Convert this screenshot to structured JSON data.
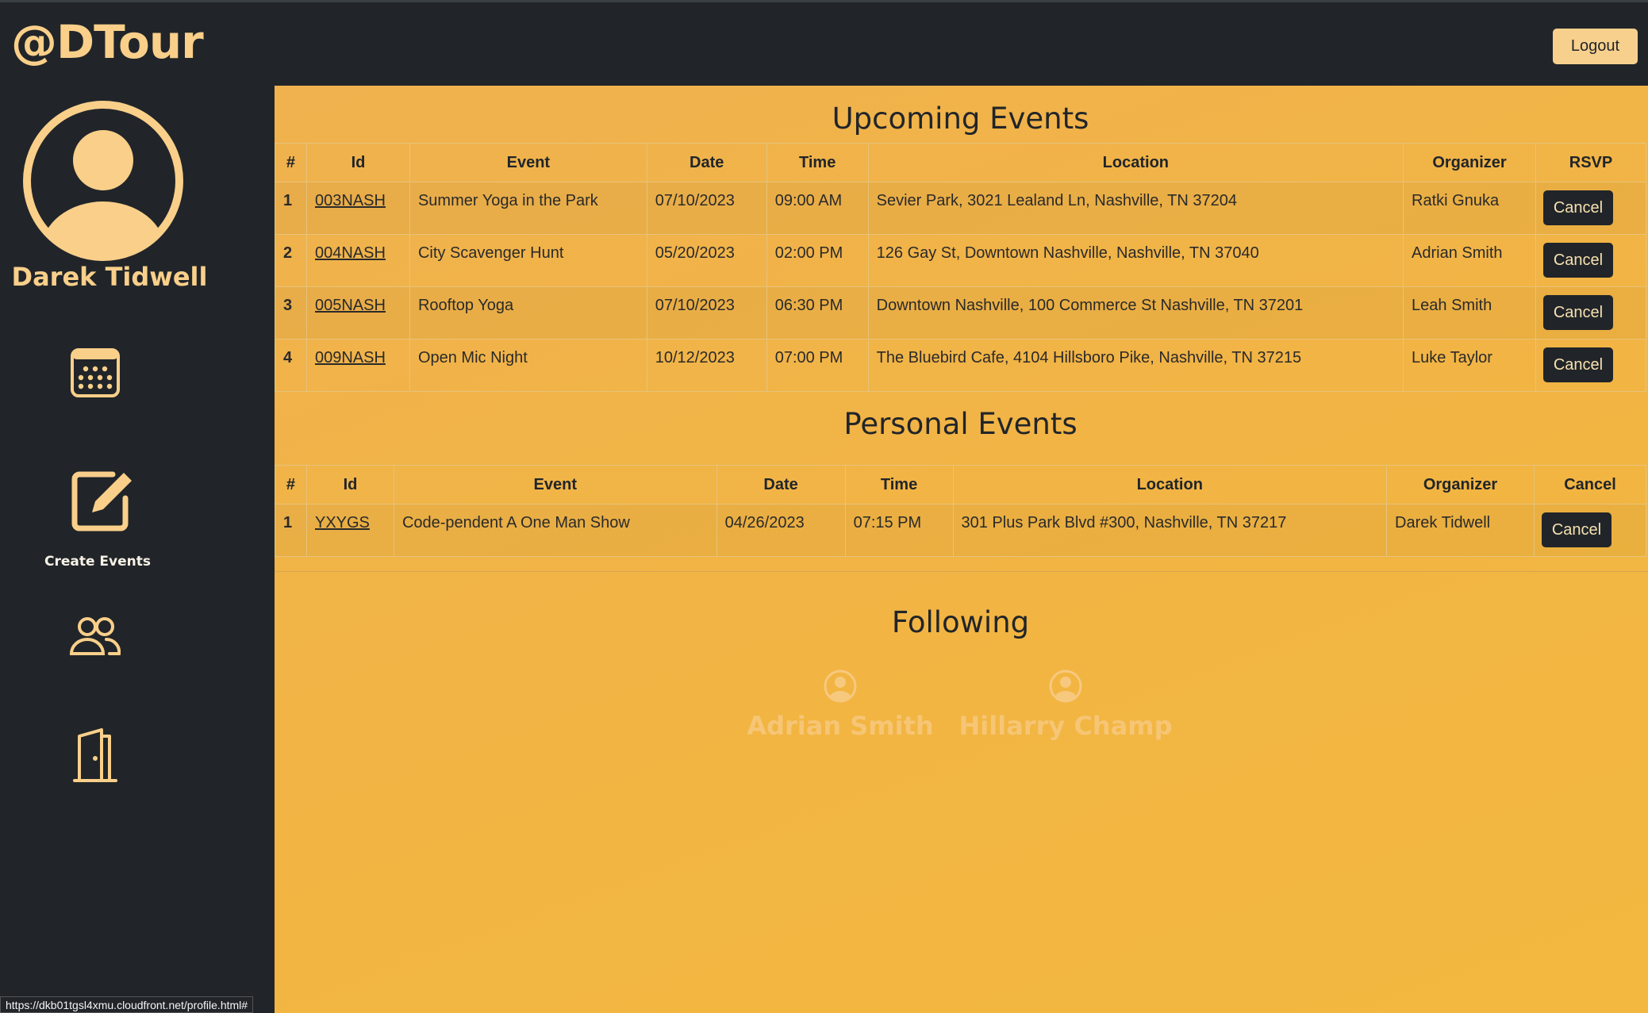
{
  "header": {
    "brand": "@DTour",
    "logout_label": "Logout"
  },
  "sidebar": {
    "user_name": "Darek Tidwell",
    "create_events_label": "Create Events",
    "icons": [
      "avatar-icon",
      "calendar-icon",
      "edit-icon",
      "users-icon",
      "door-icon"
    ]
  },
  "upcoming": {
    "title": "Upcoming Events",
    "headers": [
      "#",
      "Id",
      "Event",
      "Date",
      "Time",
      "Location",
      "Organizer",
      "RSVP"
    ],
    "rows": [
      {
        "num": "1",
        "id": "003NASH",
        "event": "Summer Yoga in the Park",
        "date": "07/10/2023",
        "time": "09:00 AM",
        "location": "Sevier Park, 3021 Lealand Ln, Nashville, TN 37204",
        "organizer": "Ratki Gnuka",
        "action": "Cancel"
      },
      {
        "num": "2",
        "id": "004NASH",
        "event": "City Scavenger Hunt",
        "date": "05/20/2023",
        "time": "02:00 PM",
        "location": "126 Gay St, Downtown Nashville, Nashville, TN 37040",
        "organizer": "Adrian Smith",
        "action": "Cancel"
      },
      {
        "num": "3",
        "id": "005NASH",
        "event": "Rooftop Yoga",
        "date": "07/10/2023",
        "time": "06:30 PM",
        "location": "Downtown Nashville, 100 Commerce St Nashville, TN 37201",
        "organizer": "Leah Smith",
        "action": "Cancel"
      },
      {
        "num": "4",
        "id": "009NASH",
        "event": "Open Mic Night",
        "date": "10/12/2023",
        "time": "07:00 PM",
        "location": "The Bluebird Cafe, 4104 Hillsboro Pike, Nashville, TN 37215",
        "organizer": "Luke Taylor",
        "action": "Cancel"
      }
    ]
  },
  "personal": {
    "title": "Personal Events",
    "headers": [
      "#",
      "Id",
      "Event",
      "Date",
      "Time",
      "Location",
      "Organizer",
      "Cancel"
    ],
    "rows": [
      {
        "num": "1",
        "id": "YXYGS",
        "event": "Code-pendent A One Man Show",
        "date": "04/26/2023",
        "time": "07:15 PM",
        "location": "301 Plus Park Blvd #300, Nashville, TN 37217",
        "organizer": "Darek Tidwell",
        "action": "Cancel"
      }
    ]
  },
  "following": {
    "title": "Following",
    "people": [
      {
        "name": "Adrian Smith"
      },
      {
        "name": "Hillarry Champ"
      }
    ]
  },
  "status_url": "https://dkb01tgsl4xmu.cloudfront.net/profile.html#",
  "colors": {
    "sidebar_bg": "#212529",
    "accent": "#f9cf8a",
    "main_bg": "#f2b542",
    "button_dark": "#212529"
  }
}
